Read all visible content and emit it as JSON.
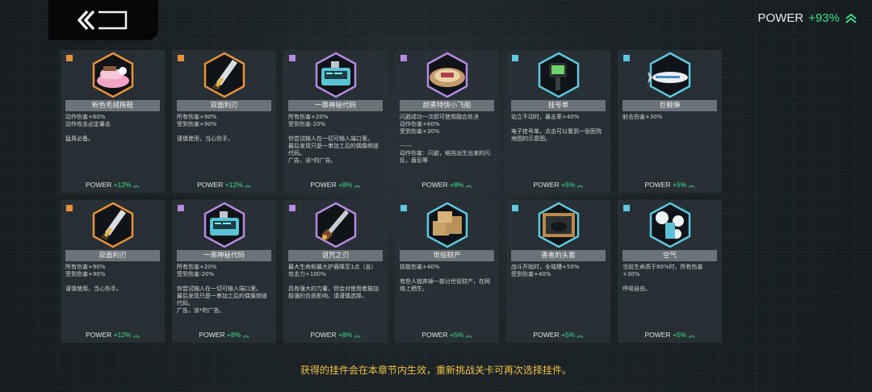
{
  "header": {
    "back_label": "",
    "power_label": "POWER",
    "power_value": "+93%"
  },
  "cards": [
    {
      "name": "粉色毛绒拖鞋",
      "rarity_color": "#e8913a",
      "icon": "slipper-icon",
      "desc": "动作伤害+60%\n动作攻击必定暴击\n\n猛男必备。",
      "power_label": "POWER",
      "power_value": "+12%"
    },
    {
      "name": "双面利刃",
      "rarity_color": "#e8913a",
      "icon": "double-blade-icon",
      "desc": "所有伤害+90%\n受到伤害+90%\n\n谨慎使用，当心伤手。",
      "power_label": "POWER",
      "power_value": "+12%"
    },
    {
      "name": "一串神秘代码",
      "rarity_color": "#b68ae0",
      "icon": "code-device-icon",
      "desc": "所有伤害+20%\n受到伤害-20%\n\n你尝试输入在一切可输入端口里。\n最后发现只是一串加工后的偶像频道代码。\n广告，该*的广告。",
      "power_label": "POWER",
      "power_value": "+8%"
    },
    {
      "name": "超勇特快小飞船",
      "rarity_color": "#b68ae0",
      "icon": "spaceship-icon",
      "desc": "闪避成功一次即可使用融合处决\n动作伤害+60%\n受到伤害+30%\n\n------\n动作伤害：闪避，格挡派生出来的闪反，盾反等",
      "power_label": "POWER",
      "power_value": "+8%"
    },
    {
      "name": "挂号单",
      "rarity_color": "#5ec8e0",
      "icon": "ticket-icon",
      "desc": "站立不动时，暴击率+40%\n\n电子挂号单，点击可以看到一张医院地图的示意图。",
      "power_label": "POWER",
      "power_value": "+5%"
    },
    {
      "name": "巨鲸弹",
      "rarity_color": "#5ec8e0",
      "icon": "whale-missile-icon",
      "desc": "射击伤害+30%",
      "power_label": "POWER",
      "power_value": "+5%"
    },
    {
      "name": "双面利刃",
      "rarity_color": "#e8913a",
      "icon": "double-blade-icon",
      "desc": "所有伤害+90%\n受到伤害+90%\n\n谨慎使用，当心伤手。",
      "power_label": "POWER",
      "power_value": "+12%"
    },
    {
      "name": "一串神秘代码",
      "rarity_color": "#b68ae0",
      "icon": "code-device-icon",
      "desc": "所有伤害+20%\n受到伤害-20%\n\n你尝试输入在一切可输入端口里。\n最后发现只是一串加工后的偶像频道代码。\n广告，该*的广告。",
      "power_label": "POWER",
      "power_value": "+8%"
    },
    {
      "name": "诅咒之刃",
      "rarity_color": "#b68ae0",
      "icon": "cursed-blade-icon",
      "desc": "最大生命和最大护盾降至1点（息）\n攻击力+100%\n\n具有强大的力量，但会对使用者施加极强的负面影响，请谨慎选择。",
      "power_label": "POWER",
      "power_value": "+8%"
    },
    {
      "name": "世俗财产",
      "rarity_color": "#5ec8e0",
      "icon": "boxes-icon",
      "desc": "技能伤害+40%\n\n有些人抛弃掉一部分世俗财产，在网络上栖生。",
      "power_label": "POWER",
      "power_value": "+5%"
    },
    {
      "name": "勇者的头套",
      "rarity_color": "#5ec8e0",
      "icon": "helmet-frame-icon",
      "desc": "战斗开始时，全域槽+50%\n受到伤害+40%",
      "power_label": "POWER",
      "power_value": "+5%"
    },
    {
      "name": "空气",
      "rarity_color": "#5ec8e0",
      "icon": "air-can-icon",
      "desc": "当前生命高于80%时，所有伤害+30%\n\n呼吸自由。",
      "power_label": "POWER",
      "power_value": "+5%"
    }
  ],
  "footer": {
    "text": "获得的挂件会在本章节内生效，重新挑战关卡可再次选择挂件。"
  }
}
